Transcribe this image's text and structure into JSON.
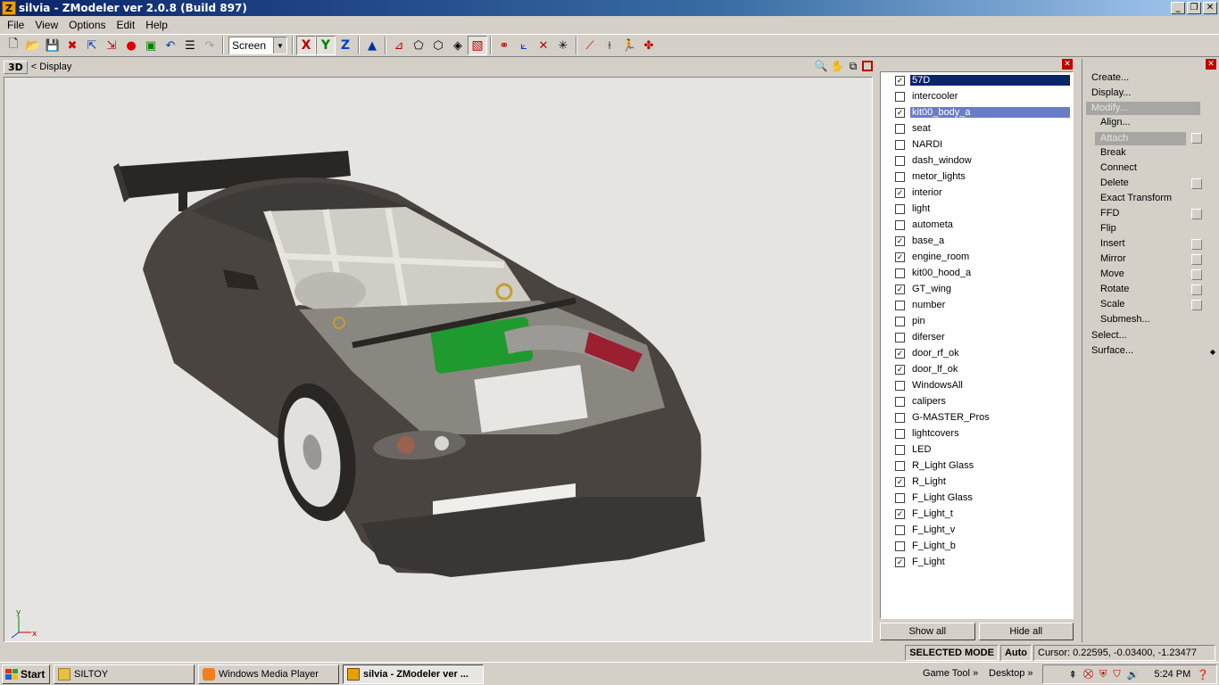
{
  "window": {
    "title": "silvia - ZModeler ver 2.0.8 (Build 897)",
    "app_icon": "Z",
    "controls": [
      "minimize-icon",
      "restore-icon",
      "close-icon"
    ]
  },
  "menu": [
    "File",
    "View",
    "Options",
    "Edit",
    "Help"
  ],
  "toolbar": {
    "coord_select": "Screen",
    "axes": [
      "X",
      "Y",
      "Z"
    ]
  },
  "viewport": {
    "badge": "3D",
    "title": "<  Display",
    "axis_labels": {
      "y": "y",
      "x": "x"
    }
  },
  "layers": {
    "items": [
      {
        "name": "57D",
        "checked": true,
        "selected": "dark"
      },
      {
        "name": "intercooler",
        "checked": false
      },
      {
        "name": "kit00_body_a",
        "checked": true,
        "selected": "light"
      },
      {
        "name": "seat",
        "checked": false
      },
      {
        "name": "NARDI",
        "checked": false
      },
      {
        "name": "dash_window",
        "checked": false
      },
      {
        "name": "metor_lights",
        "checked": false
      },
      {
        "name": "interior",
        "checked": true
      },
      {
        "name": "light",
        "checked": false
      },
      {
        "name": "autometa",
        "checked": false
      },
      {
        "name": "base_a",
        "checked": true
      },
      {
        "name": "engine_room",
        "checked": true
      },
      {
        "name": "kit00_hood_a",
        "checked": false
      },
      {
        "name": "GT_wing",
        "checked": true
      },
      {
        "name": "number",
        "checked": false
      },
      {
        "name": "pin",
        "checked": false
      },
      {
        "name": "diferser",
        "checked": false
      },
      {
        "name": "door_rf_ok",
        "checked": true
      },
      {
        "name": "door_lf_ok",
        "checked": true
      },
      {
        "name": "WindowsAll",
        "checked": false
      },
      {
        "name": "calipers",
        "checked": false
      },
      {
        "name": "G-MASTER_Pros",
        "checked": false
      },
      {
        "name": "lightcovers",
        "checked": false
      },
      {
        "name": "LED",
        "checked": false
      },
      {
        "name": "R_Light Glass",
        "checked": false
      },
      {
        "name": "R_Light",
        "checked": true
      },
      {
        "name": "F_Light Glass",
        "checked": false
      },
      {
        "name": "F_Light_t",
        "checked": true
      },
      {
        "name": "F_Light_v",
        "checked": false
      },
      {
        "name": "F_Light_b",
        "checked": false
      },
      {
        "name": "F_Light",
        "checked": true
      }
    ],
    "show_all": "Show all",
    "hide_all": "Hide all"
  },
  "commands": {
    "create": "Create...",
    "display": "Display...",
    "modify": "Modify...",
    "sub": [
      {
        "label": "Align...",
        "box": false
      },
      {
        "label": "Attach",
        "box": true,
        "active": true
      },
      {
        "label": "Break",
        "box": false
      },
      {
        "label": "Connect",
        "box": false
      },
      {
        "label": "Delete",
        "box": true
      },
      {
        "label": "Exact Transform",
        "box": false
      },
      {
        "label": "FFD",
        "box": true
      },
      {
        "label": "Flip",
        "box": false
      },
      {
        "label": "Insert",
        "box": true
      },
      {
        "label": "Mirror",
        "box": true
      },
      {
        "label": "Move",
        "box": true
      },
      {
        "label": "Rotate",
        "box": true
      },
      {
        "label": "Scale",
        "box": true
      },
      {
        "label": "Submesh...",
        "box": false
      }
    ],
    "select": "Select...",
    "surface": "Surface..."
  },
  "status": {
    "mode": "SELECTED MODE",
    "auto": "Auto",
    "cursor": "Cursor: 0.22595, -0.03400, -1.23477"
  },
  "taskbar": {
    "start": "Start",
    "tasks": [
      {
        "label": "SILTOY",
        "active": false
      },
      {
        "label": "Windows Media Player",
        "active": false
      },
      {
        "label": "silvia - ZModeler ver ...",
        "active": true
      }
    ],
    "groups": [
      "Game Tool",
      "Desktop"
    ],
    "clock": "5:24 PM"
  },
  "colors": {
    "title_bar": "#0a246a",
    "selection_dark": "#0a246a",
    "selection_light": "#6a7cc8",
    "viewport_bg": "#e6e4e0",
    "car_body": "#4a4440",
    "engine_green": "#1e9a2e",
    "intake_red": "#9a2030"
  }
}
